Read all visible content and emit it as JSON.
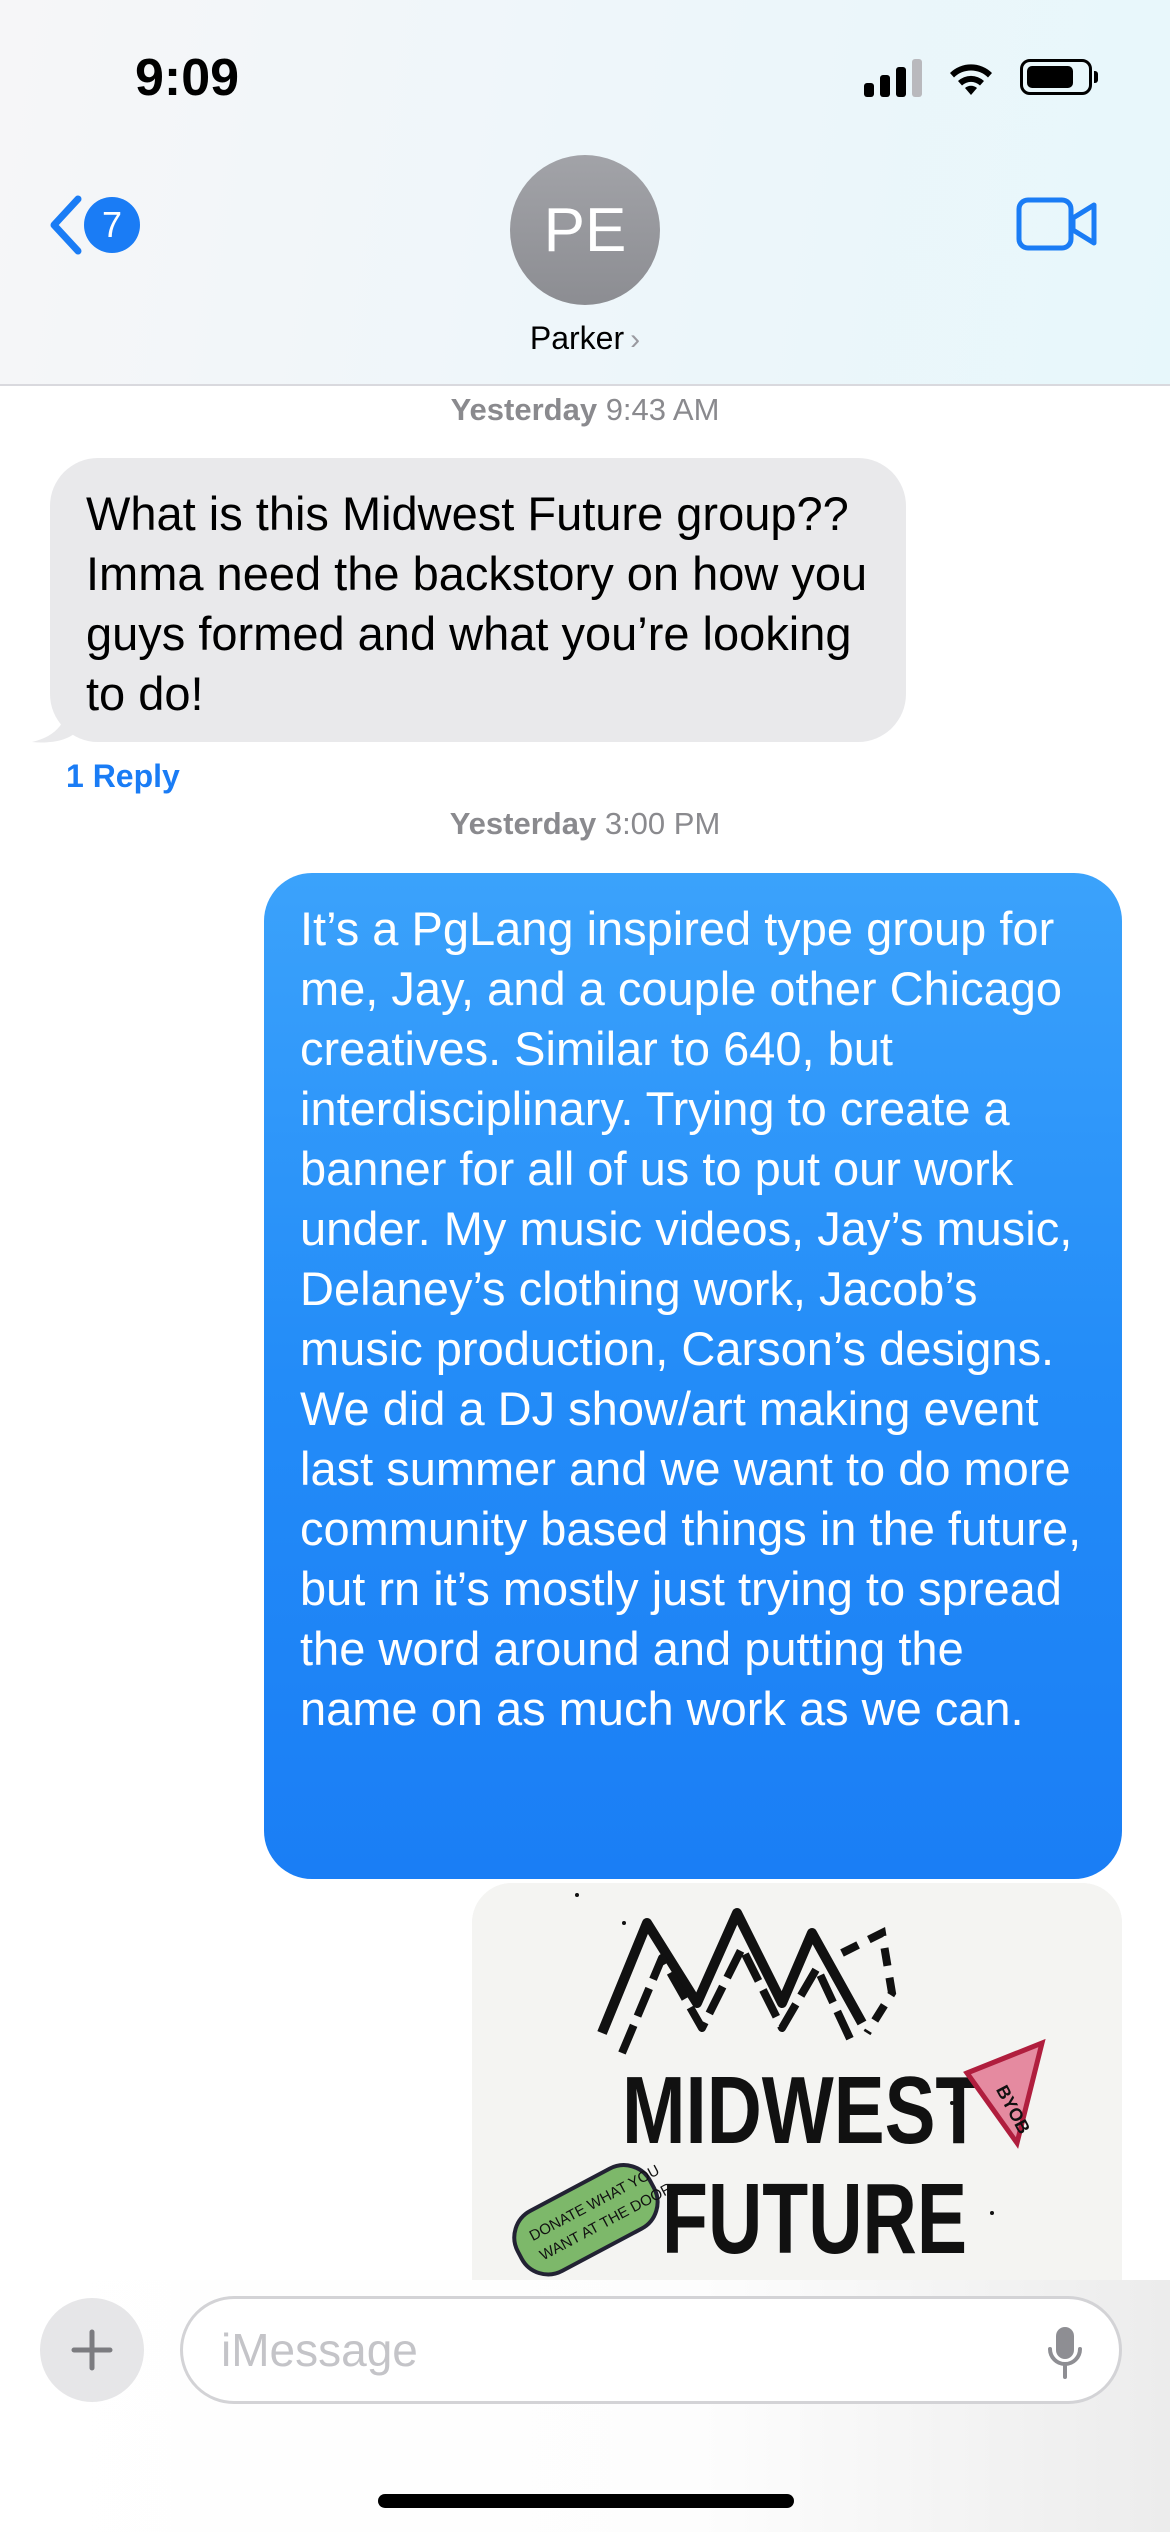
{
  "status_bar": {
    "time": "9:09"
  },
  "header": {
    "back_badge_count": "7",
    "avatar_initials": "PE",
    "contact_name": "Parker",
    "contact_chevron": "›"
  },
  "messages": [
    {
      "timestamp_day": "Yesterday",
      "timestamp_time": "9:43 AM",
      "direction": "incoming",
      "text": "What is this Midwest Future group?? Imma need the backstory on how you guys formed and what you’re looking to do!",
      "reply_label": "1 Reply"
    },
    {
      "timestamp_day": "Yesterday",
      "timestamp_time": "3:00 PM",
      "direction": "outgoing",
      "text": "It’s a PgLang inspired type group for me, Jay, and a couple other Chicago creatives. Similar to 640, but interdisciplinary. Trying to create a banner for all of us to put our work under. My music videos, Jay’s music, Delaney’s clothing work, Jacob’s music production, Carson’s designs. We did a DJ show/art making event last summer and we want to do more community based things in the future, but rn it’s mostly just trying to spread the word around and putting the name on as much work as we can."
    }
  ],
  "photo": {
    "title_line1": "MIDWEST",
    "title_line2": "FUTURE",
    "badge_text": "BYOB",
    "sticker_line1": "DONATE WHAT YOU",
    "sticker_line2": "WANT AT THE DOOR"
  },
  "compose": {
    "placeholder": "iMessage"
  },
  "colors": {
    "accent_blue": "#1a7cf5",
    "incoming_bubble": "#e9e9eb",
    "outgoing_bubble_top": "#3ba2fb",
    "outgoing_bubble_bottom": "#1a7ef5"
  },
  "icons": [
    "back-chevron-icon",
    "video-camera-icon",
    "plus-icon",
    "microphone-icon",
    "wifi-icon",
    "battery-icon",
    "signal-icon"
  ]
}
